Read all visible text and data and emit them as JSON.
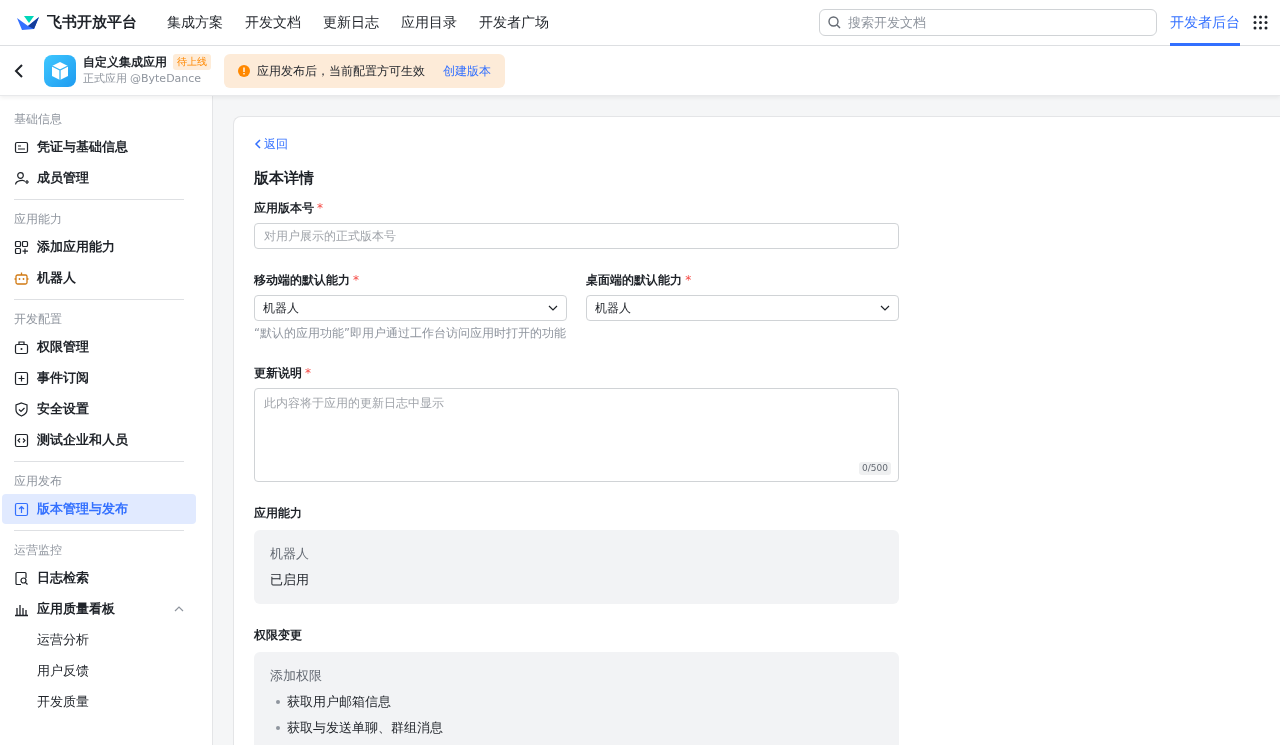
{
  "header": {
    "brand": "飞书开放平台",
    "nav": [
      {
        "label": "集成方案",
        "selected": false
      },
      {
        "label": "开发文档",
        "selected": false
      },
      {
        "label": "更新日志",
        "selected": false
      },
      {
        "label": "应用目录",
        "selected": false
      },
      {
        "label": "开发者广场",
        "selected": false
      }
    ],
    "search": {
      "placeholder": "搜索开发文档"
    },
    "console_link": {
      "label": "开发者后台",
      "selected": true
    }
  },
  "app_bar": {
    "app_name": "自定义集成应用",
    "status_badge": "待上线",
    "subtitle": "正式应用 @ByteDance",
    "notice": {
      "text": "应用发布后，当前配置方可生效",
      "action": "创建版本"
    }
  },
  "sidebar": [
    {
      "title": "基础信息",
      "items": [
        {
          "label": "凭证与基础信息",
          "selected": false
        },
        {
          "label": "成员管理",
          "selected": false
        }
      ]
    },
    {
      "title": "应用能力",
      "items": [
        {
          "label": "添加应用能力",
          "selected": false
        },
        {
          "label": "机器人",
          "selected": false
        }
      ]
    },
    {
      "title": "开发配置",
      "items": [
        {
          "label": "权限管理",
          "selected": false
        },
        {
          "label": "事件订阅",
          "selected": false
        },
        {
          "label": "安全设置",
          "selected": false
        },
        {
          "label": "测试企业和人员",
          "selected": false
        }
      ]
    },
    {
      "title": "应用发布",
      "items": [
        {
          "label": "版本管理与发布",
          "selected": true
        }
      ]
    },
    {
      "title": "运营监控",
      "items": [
        {
          "label": "日志检索",
          "selected": false
        },
        {
          "label": "应用质量看板",
          "selected": false,
          "expanded": true,
          "children": [
            {
              "label": "运营分析",
              "selected": false
            },
            {
              "label": "用户反馈",
              "selected": false
            },
            {
              "label": "开发质量",
              "selected": false
            }
          ]
        }
      ]
    }
  ],
  "main": {
    "back_link": "返回",
    "title": "版本详情",
    "version_field": {
      "label": "应用版本号",
      "required_mark": "*",
      "placeholder": "对用户展示的正式版本号"
    },
    "mobile_default": {
      "label": "移动端的默认能力",
      "required_mark": "*",
      "value": "机器人"
    },
    "desktop_default": {
      "label": "桌面端的默认能力",
      "required_mark": "*",
      "value": "机器人"
    },
    "default_hint": "“默认的应用功能”即用户通过工作台访问应用时打开的功能",
    "notes_field": {
      "label": "更新说明",
      "required_mark": "*",
      "placeholder": "此内容将于应用的更新日志中显示",
      "counter": "0/500"
    },
    "capabilities": {
      "title": "应用能力",
      "name": "机器人",
      "status": "已启用"
    },
    "permissions": {
      "title": "权限变更",
      "group": "添加权限",
      "items": [
        "获取用户邮箱信息",
        "获取与发送单聊、群组消息"
      ]
    }
  }
}
